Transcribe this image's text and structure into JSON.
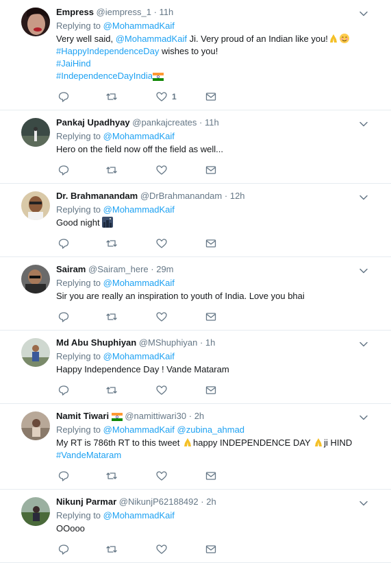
{
  "tweets": [
    {
      "name": "Empress",
      "handle": "@iempress_1",
      "time": "11h",
      "replying_label": "Replying to",
      "replying_to": [
        "@MohammadKaif"
      ],
      "lines": [
        [
          {
            "t": "text",
            "v": "Very well said, "
          },
          {
            "t": "mention",
            "v": "@MohammadKaif"
          },
          {
            "t": "text",
            "v": "  Ji. Very proud of an Indian like you!"
          },
          {
            "t": "emoji",
            "v": "pray"
          },
          {
            "t": "emoji",
            "v": "smile"
          }
        ],
        [
          {
            "t": "hashtag",
            "v": "#HappyIndependenceDay"
          },
          {
            "t": "text",
            "v": " wishes to you!"
          }
        ],
        [
          {
            "t": "hashtag",
            "v": "#JaiHind"
          }
        ],
        [
          {
            "t": "hashtag",
            "v": "#IndependenceDayIndia"
          },
          {
            "t": "emoji",
            "v": "flag"
          }
        ]
      ],
      "likes": "1"
    },
    {
      "name": "Pankaj Upadhyay",
      "handle": "@pankajcreates",
      "time": "11h",
      "replying_label": "Replying to",
      "replying_to": [
        "@MohammadKaif"
      ],
      "lines": [
        [
          {
            "t": "text",
            "v": "Hero on the field now off the field as well..."
          }
        ]
      ],
      "likes": ""
    },
    {
      "name": "Dr. Brahmanandam",
      "handle": "@DrBrahmanandam",
      "time": "12h",
      "replying_label": "Replying to",
      "replying_to": [
        "@MohammadKaif"
      ],
      "lines": [
        [
          {
            "t": "text",
            "v": "Good night "
          },
          {
            "t": "emoji",
            "v": "night"
          }
        ]
      ],
      "likes": ""
    },
    {
      "name": "Sairam",
      "handle": "@Sairam_here",
      "time": "29m",
      "replying_label": "Replying to",
      "replying_to": [
        "@MohammadKaif"
      ],
      "lines": [
        [
          {
            "t": "text",
            "v": "Sir you are really an inspiration to youth of India. Love you bhai"
          }
        ]
      ],
      "likes": ""
    },
    {
      "name": "Md Abu Shuphiyan",
      "handle": "@MShuphiyan",
      "time": "1h",
      "replying_label": "Replying to",
      "replying_to": [
        "@MohammadKaif"
      ],
      "lines": [
        [
          {
            "t": "text",
            "v": "Happy Independence Day ! Vande Mataram"
          }
        ]
      ],
      "likes": ""
    },
    {
      "name": "Namit Tiwari",
      "name_flag": true,
      "handle": "@namittiwari30",
      "time": "2h",
      "replying_label": "Replying to",
      "replying_to": [
        "@MohammadKaif",
        "@zubina_ahmad"
      ],
      "lines": [
        [
          {
            "t": "text",
            "v": "My RT is 786th RT to this tweet "
          },
          {
            "t": "emoji",
            "v": "pray"
          },
          {
            "t": "text",
            "v": "happy INDEPENDENCE DAY "
          },
          {
            "t": "emoji",
            "v": "pray"
          },
          {
            "t": "text",
            "v": "ji HIND"
          }
        ],
        [
          {
            "t": "hashtag",
            "v": "#VandeMataram"
          }
        ]
      ],
      "likes": ""
    },
    {
      "name": "Nikunj Parmar",
      "handle": "@NikunjP62188492",
      "time": "2h",
      "replying_label": "Replying to",
      "replying_to": [
        "@MohammadKaif"
      ],
      "lines": [
        [
          {
            "t": "text",
            "v": "OOooo"
          }
        ]
      ],
      "likes": ""
    }
  ],
  "dot": "·",
  "colors": {
    "link": "#1da1f2",
    "secondary": "#657786",
    "border": "#e6ecf0"
  }
}
